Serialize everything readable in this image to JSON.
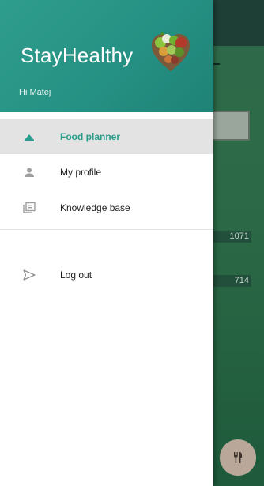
{
  "drawer": {
    "app_title": "StayHealthy",
    "greeting": "Hi Matej",
    "items": [
      {
        "label": "Food planner",
        "icon": "cloud-upload-icon",
        "active": true
      },
      {
        "label": "My profile",
        "icon": "person-icon",
        "active": false
      },
      {
        "label": "Knowledge base",
        "icon": "library-icon",
        "active": false
      }
    ],
    "secondary_items": [
      {
        "label": "Log out",
        "icon": "send-icon"
      }
    ]
  },
  "background": {
    "values": [
      "1071",
      "714"
    ],
    "fab_icon": "restaurant-icon"
  },
  "colors": {
    "header": "#259184",
    "accent": "#2a9d8c",
    "active_row": "#e3e3e3"
  }
}
